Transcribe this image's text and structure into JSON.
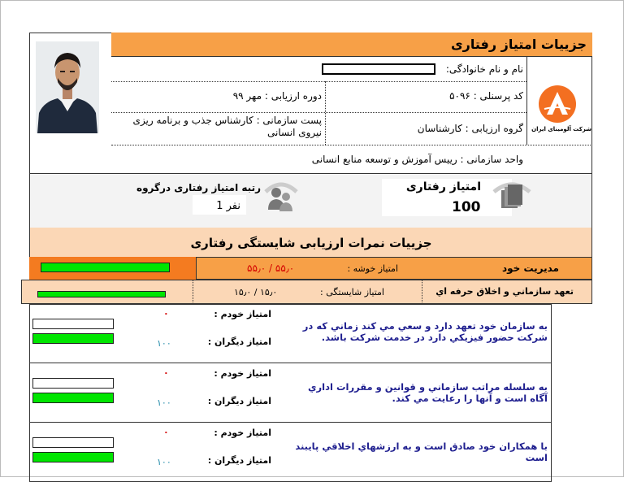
{
  "header": {
    "title": "جزییات امتیاز رفتاری"
  },
  "employee": {
    "name_label": "نام و نام خانوادگی:",
    "code_label": "کد پرسنلی :",
    "code_value": "۵۰۹۶",
    "period_label": "دوره ارزیابی :",
    "period_value": "مهر ۹۹",
    "group_label": "گروه ارزیابی :",
    "group_value": "کارشناسان",
    "position_label": "پست سازمانی :",
    "position_value": "کارشناس جذب و برنامه ریزی نیروی انسانی",
    "unit_label": "واحد سازمانی :",
    "unit_value": "رییس آموزش و توسعه منابع انسانی"
  },
  "logo": {
    "text": "شرکت آلومینای ایران",
    "color": "#f36f21"
  },
  "summary": {
    "score_label": "امتیاز رفتاری",
    "score_value": "100",
    "rank_label": "رتبه امتیاز رفتاری درگروه",
    "rank_value": "نفر 1"
  },
  "section": {
    "title": "جزییات نمرات ارزیابی شایستگی رفتاری"
  },
  "cluster": {
    "name": "مدیریت خود",
    "score_label": "امتیاز خوشه :",
    "score_value": "۵۵٫۰ / ۵۵٫۰",
    "progress": 1.0
  },
  "competency": {
    "name": "تعهد سازماني و اخلاق حرفه اي",
    "score_label": "امتیاز شایستگی :",
    "score_value": "۱۵٫۰ / ۱۵٫۰",
    "progress": 1.0
  },
  "items": [
    {
      "text": "به سازمان خود تعهد دارد و سعي مي كند زماني كه در شركت حضور فيزيكي دارد در خدمت شركت باشد.",
      "self_label": "امتیاز خودم :",
      "self_value": "۰",
      "others_label": "امتیاز دیگران :",
      "others_value": "۱۰۰"
    },
    {
      "text": "به سلسله مراتب سازماني و قوانين و مقررات اداري آگاه است و آنها را رعايت مي كند.",
      "self_label": "امتیاز خودم :",
      "self_value": "۰",
      "others_label": "امتیاز دیگران :",
      "others_value": "۱۰۰"
    },
    {
      "text": "با همكاران خود صادق است و به ارزشهاي اخلاقي پايبند است",
      "self_label": "امتیاز خودم :",
      "self_value": "۰",
      "others_label": "امتیاز دیگران :",
      "others_value": "۱۰۰"
    }
  ],
  "colors": {
    "orange": "#f7a047",
    "peach": "#fbd7b6",
    "green": "#00e600",
    "blue_text": "#1f1f8f",
    "red": "#d40000",
    "teal": "#1d88a8"
  }
}
